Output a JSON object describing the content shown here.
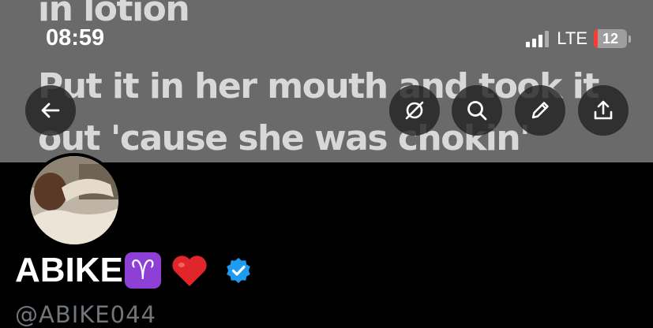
{
  "status_bar": {
    "time": "08:59",
    "network": "LTE",
    "battery_level": "12",
    "battery_fraction": 0.12
  },
  "banner": {
    "lyric_lines": [
      "in lotion",
      "Put it in her mouth and took it",
      "out 'cause she was chokin'"
    ]
  },
  "toolbar": {
    "buttons": [
      {
        "icon": "back-arrow-icon"
      },
      {
        "icon": "grok-icon"
      },
      {
        "icon": "search-icon"
      },
      {
        "icon": "pencil-icon"
      },
      {
        "icon": "share-icon"
      }
    ]
  },
  "profile": {
    "display_name": "ABIKE",
    "aries_emoji": "♈",
    "heart_emoji": "❤️",
    "verified": true,
    "handle": "@ABIKE044"
  },
  "colors": {
    "banner_bg": "#6a6a6a",
    "page_bg": "#000000",
    "verified_blue": "#1d9bf0",
    "handle_gray": "#71767b",
    "battery_low": "#ff3b30",
    "aries_purple": "#8e3fd6"
  }
}
